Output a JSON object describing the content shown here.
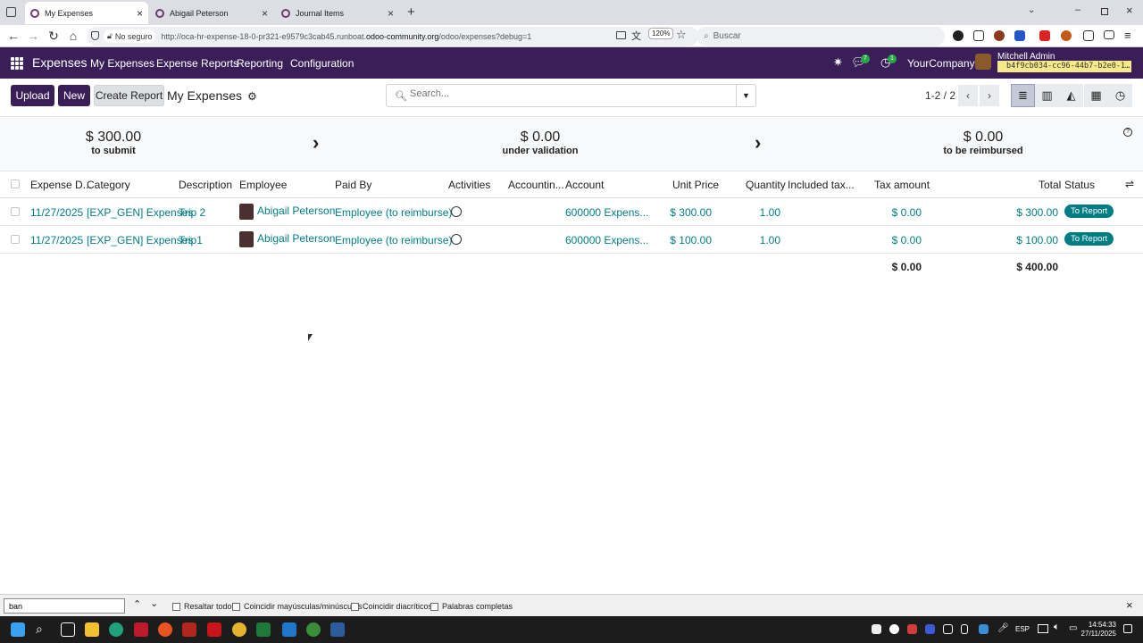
{
  "browser": {
    "tabs": [
      {
        "label": "My Expenses",
        "active": true
      },
      {
        "label": "Abigail Peterson",
        "active": false
      },
      {
        "label": "Journal Items",
        "active": false
      }
    ],
    "security_label": "No seguro",
    "url_prefix": "http://oca-hr-expense-18-0-pr321-e9579c3cab45.runboat.",
    "url_domain": "odoo-community.org",
    "url_suffix": "/odoo/expenses?debug=1",
    "zoom": "120%",
    "search_placeholder": "Buscar"
  },
  "navbar": {
    "app_title": "Expenses",
    "menus": [
      "My Expenses",
      "Expense Reports",
      "Reporting",
      "Configuration"
    ],
    "messages_count": "7",
    "activities_count": "1",
    "company": "YourCompany",
    "user": "Mitchell Admin",
    "debug_hash": "b4f9cb034-cc96-44b7-b2e0-1…"
  },
  "control": {
    "upload_label": "Upload",
    "new_label": "New",
    "create_report_label": "Create Report",
    "view_title": "My Expenses",
    "search_placeholder": "Search...",
    "pager": "1-2 / 2"
  },
  "stats": [
    {
      "amount": "$ 300.00",
      "label": "to submit"
    },
    {
      "amount": "$ 0.00",
      "label": "under validation"
    },
    {
      "amount": "$ 0.00",
      "label": "to be reimbursed"
    }
  ],
  "table": {
    "headers": [
      "Expense D...",
      "Category",
      "Description",
      "Employee",
      "Paid By",
      "Activities",
      "Accountin...",
      "Account",
      "Unit Price",
      "Quantity",
      "Included tax...",
      "Tax amount",
      "Total",
      "Status"
    ],
    "rows": [
      {
        "date": "11/27/2025",
        "category": "[EXP_GEN] Expenses",
        "description": "Trip 2",
        "employee": "Abigail Peterson",
        "paid_by": "Employee (to reimburse)",
        "account": "600000 Expens...",
        "unit_price": "$ 300.00",
        "quantity": "1.00",
        "tax_amount": "$ 0.00",
        "total": "$ 300.00",
        "status": "To Report"
      },
      {
        "date": "11/27/2025",
        "category": "[EXP_GEN] Expenses",
        "description": "Trip1",
        "employee": "Abigail Peterson",
        "paid_by": "Employee (to reimburse)",
        "account": "600000 Expens...",
        "unit_price": "$ 100.00",
        "quantity": "1.00",
        "tax_amount": "$ 0.00",
        "total": "$ 100.00",
        "status": "To Report"
      }
    ],
    "totals": {
      "tax_amount": "$ 0.00",
      "total": "$ 400.00"
    }
  },
  "findbar": {
    "query": "ban",
    "options": [
      "Resaltar todo",
      "Coincidir mayúsculas/minúsculas",
      "Coincidir diacríticos",
      "Palabras completas"
    ]
  },
  "taskbar": {
    "lang": "ESP",
    "time": "14:54:33",
    "date": "27/11/2025"
  },
  "colors": {
    "brand": "#3a1e58",
    "link": "#017e84",
    "badge": "#017e84"
  }
}
